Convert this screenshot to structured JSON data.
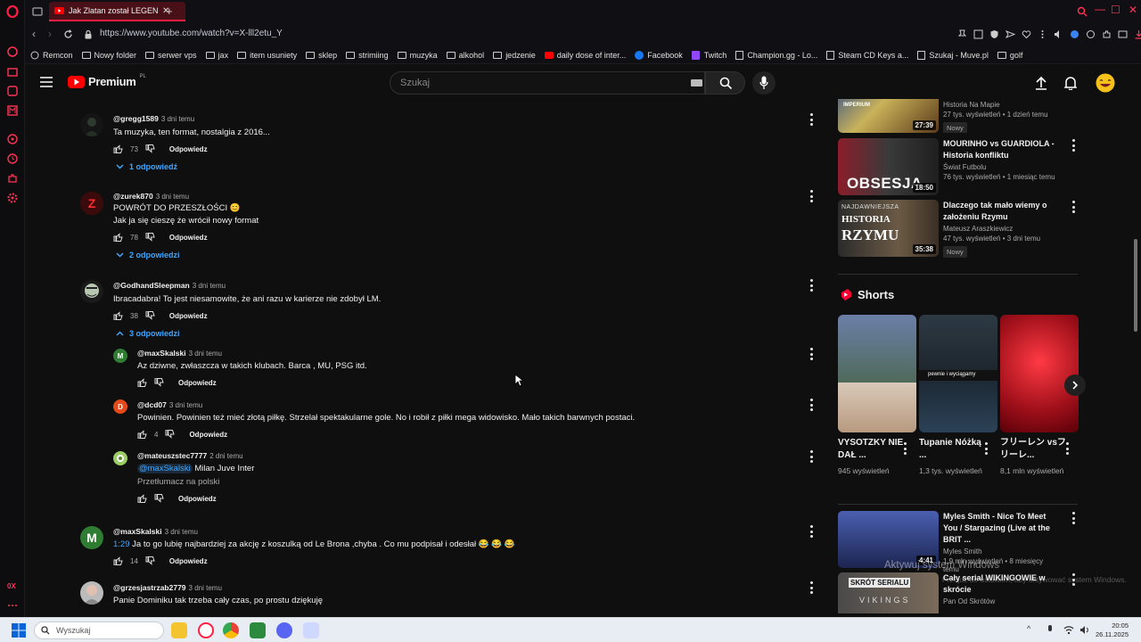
{
  "browser": {
    "tab_title": "Jak Zlatan został LEGENDĄ",
    "new_tab": "+",
    "url": "https://www.youtube.com/watch?v=X-lll2etu_Y",
    "bookmarks": [
      {
        "label": "Remcon",
        "icon": "globe-icon"
      },
      {
        "label": "Nowy folder",
        "icon": "folder-icon"
      },
      {
        "label": "serwer vps",
        "icon": "folder-icon"
      },
      {
        "label": "jax",
        "icon": "folder-icon"
      },
      {
        "label": "item usuniety",
        "icon": "folder-icon"
      },
      {
        "label": "sklep",
        "icon": "folder-icon"
      },
      {
        "label": "strimiing",
        "icon": "folder-icon"
      },
      {
        "label": "muzyka",
        "icon": "folder-icon"
      },
      {
        "label": "alkohol",
        "icon": "folder-icon"
      },
      {
        "label": "jedzenie",
        "icon": "folder-icon"
      },
      {
        "label": "daily dose of inter...",
        "icon": "youtube-icon"
      },
      {
        "label": "Facebook",
        "icon": "facebook-icon"
      },
      {
        "label": "Twitch",
        "icon": "twitch-icon"
      },
      {
        "label": "Champion.gg - Lo...",
        "icon": "page-icon"
      },
      {
        "label": "Steam CD Keys a...",
        "icon": "page-icon"
      },
      {
        "label": "Szukaj - Muve.pl",
        "icon": "page-icon"
      },
      {
        "label": "golf",
        "icon": "folder-icon"
      }
    ]
  },
  "youtube": {
    "logo_text": "Premium",
    "logo_badge": "PL",
    "search_placeholder": "Szukaj",
    "avatar_icon": "laughing-emoji-icon"
  },
  "comments": [
    {
      "author": "@gregg1589",
      "time": "3 dni temu",
      "text": [
        "Ta muzyka, ten format, nostalgia z 2016..."
      ],
      "likes": "73",
      "reply": "Odpowiedz",
      "replies": "1 odpowiedź",
      "replies_open": false,
      "avatar": ""
    },
    {
      "author": "@zurek870",
      "time": "3 dni temu",
      "text": [
        "POWRÓT DO PRZESZŁOŚCI 😊",
        "Jak ja się cieszę że wrócił nowy format"
      ],
      "likes": "78",
      "reply": "Odpowiedz",
      "replies": "2 odpowiedzi",
      "replies_open": false,
      "avatar": "Z"
    },
    {
      "author": "@GodhandSleepman",
      "time": "3 dni temu",
      "text": [
        "Ibracadabra! To jest niesamowite, że ani razu w karierze nie zdobył LM."
      ],
      "likes": "38",
      "reply": "Odpowiedz",
      "replies": "3 odpowiedzi",
      "replies_open": true,
      "avatar": ""
    },
    {
      "author": "@maxSkalski",
      "time": "3 dni temu",
      "text": [
        "Ja to go lubię najbardziej za akcję z koszulką od Le Brona ,chyba . Co mu podpisał i odesłał 😂 😂 😂"
      ],
      "timestamp_link": "1:29",
      "likes": "14",
      "reply": "Odpowiedz",
      "avatar": "M"
    },
    {
      "author": "@grzesjastrzab2779",
      "time": "3 dni temu",
      "text": [
        "Panie Dominiku tak trzeba cały czas, po prostu dziękuję"
      ],
      "avatar": ""
    }
  ],
  "replies": [
    {
      "author": "@maxSkalski",
      "time": "3 dni temu",
      "text": "Az dziwne, zwłaszcza w takich klubach. Barca , MU, PSG itd.",
      "likes": "",
      "reply": "Odpowiedz",
      "avatar": "M"
    },
    {
      "author": "@dcd07",
      "time": "3 dni temu",
      "text": "Powinien. Powinien też mieć złotą piłkę. Strzelał spektakularne gole. No i robił z piłki mega widowisko. Mało takich barwnych postaci.",
      "likes": "4",
      "reply": "Odpowiedz",
      "avatar": "D"
    },
    {
      "author": "@mateuszstec7777",
      "time": "2 dni temu",
      "mention": "@maxSkalski",
      "text": " Milan Juve Inter",
      "translate": "Przetłumacz na polski",
      "likes": "",
      "reply": "Odpowiedz",
      "avatar": ""
    }
  ],
  "related": [
    {
      "title": "",
      "channel": "Historia Na Mapie",
      "stats": "27 tys. wyświetleń • 1 dzień temu",
      "badge": "Nowy",
      "duration": "27:39"
    },
    {
      "title": "MOURINHO vs GUARDIOLA - Historia konfliktu",
      "channel": "Świat Futbolu",
      "stats": "76 tys. wyświetleń • 1 miesiąc temu",
      "badge": "",
      "duration": "18:50"
    },
    {
      "title": "Dlaczego tak mało wiemy o założeniu Rzymu",
      "channel": "Mateusz Araszkiewicz",
      "stats": "47 tys. wyświetleń • 3 dni temu",
      "badge": "Nowy",
      "duration": "35:38"
    },
    {
      "title": "Myles Smith - Nice To Meet You / Stargazing (Live at the BRIT ...",
      "channel": "Myles Smith",
      "stats": "1,9 mln wyświetleń • 8 miesięcy temu",
      "badge": "",
      "duration": "4:41"
    },
    {
      "title": "Cały serial WIKINGOWIE w skrócie",
      "channel": "Pan Od Skrótów",
      "stats": "",
      "badge": "",
      "duration": ""
    }
  ],
  "thumb_text": {
    "t1": "IMPERIUM",
    "t2": "OBSESJA",
    "t3a": "NAJDAWNIEJSZA",
    "t3b": "HISTORIA",
    "t3c": "RZYMU",
    "t5a": "SKRÓT SERIALU",
    "t5b": "VIKINGS"
  },
  "shorts_header": "Shorts",
  "shorts": [
    {
      "title": "VYSOTZKY NIE DAŁ ...",
      "views": "945 wyświetleń"
    },
    {
      "title": "Tupanie Nóżką ...",
      "views": "1,3 tys. wyświetleń"
    },
    {
      "title": "フリーレン vsフリーレ...",
      "views": "8,1 mln wyświetleń"
    }
  ],
  "shorts_overlay": "pewnie i wyciągamy",
  "watermark": {
    "title": "Aktywuj system Windows",
    "sub": "Przejdź do ustawień, aby aktywować system Windows."
  },
  "taskbar": {
    "search_placeholder": "Wyszukaj",
    "time": "20:05",
    "date": "26.11.2025"
  },
  "colors": {
    "accent": "#ff1f44",
    "link": "#3ea6ff",
    "bg": "#0f0f0f"
  }
}
